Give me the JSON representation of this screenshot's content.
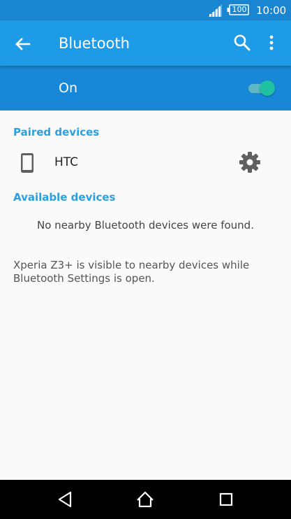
{
  "status_bar": {
    "battery_level": "100",
    "clock": "10:00"
  },
  "app_bar": {
    "title": "Bluetooth",
    "icons": [
      "back-arrow-icon",
      "search-icon",
      "more-vert-icon"
    ]
  },
  "main_switch": {
    "label": "On",
    "checked": true
  },
  "paired": {
    "header": "Paired devices",
    "devices": [
      {
        "name": "HTC",
        "icon": "smartphone-icon"
      }
    ]
  },
  "available": {
    "header": "Available devices",
    "empty_message": "No nearby Bluetooth devices were found."
  },
  "visibility_message": "Xperia Z3+ is visible to nearby devices while Bluetooth Settings is open.",
  "colors": {
    "status_bar": "#1a86d1",
    "app_bar": "#1e9be6",
    "switch_bar": "#1887d7",
    "accent_text": "#2aa0e0",
    "toggle_thumb": "#20c0a2"
  }
}
